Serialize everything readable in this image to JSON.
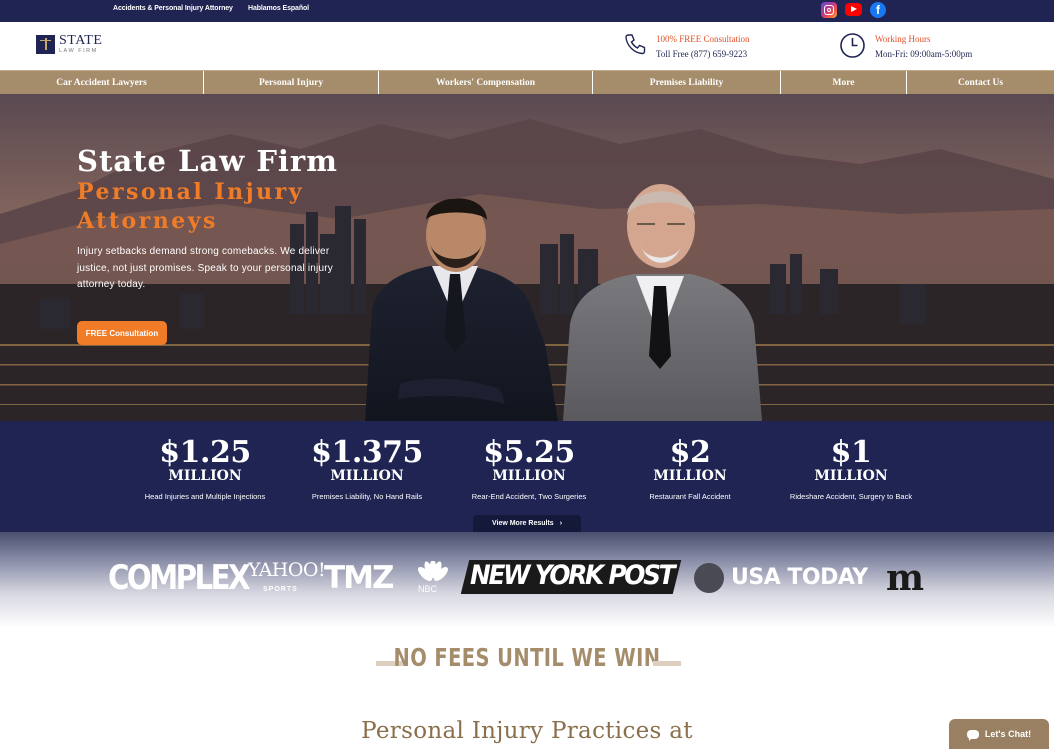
{
  "topbar": {
    "attorney_link": "Accidents & Personal Injury Attorney",
    "espanol_link": "Hablamos Español",
    "social_icons": [
      "instagram-icon",
      "youtube-icon",
      "facebook-icon"
    ]
  },
  "header": {
    "logo_title": "STATE",
    "logo_subtitle": "LAW FIRM",
    "consultation_label": "100% FREE Consultation",
    "toll_free": "Toll Free (877) 659-9223",
    "hours_label": "Working Hours",
    "hours_value": "Mon-Fri: 09:00am-5:00pm"
  },
  "nav": {
    "items": [
      {
        "label": "Car Accident Lawyers"
      },
      {
        "label": "Personal Injury"
      },
      {
        "label": "Workers' Compensation"
      },
      {
        "label": "Premises Liability"
      },
      {
        "label": "More"
      },
      {
        "label": "Contact Us"
      }
    ]
  },
  "hero": {
    "title": "State Law Firm",
    "subtitle": "Personal Injury Attorneys",
    "description": "Injury setbacks demand strong comebacks. We deliver justice, not just promises. Speak to your personal injury attorney today.",
    "cta_label": "FREE Consultation"
  },
  "results": {
    "items": [
      {
        "amount": "$1.25",
        "unit": "MILLION",
        "desc": "Head Injuries and Multiple Injections"
      },
      {
        "amount": "$1.375",
        "unit": "MILLION",
        "desc": "Premises Liability, No Hand Rails"
      },
      {
        "amount": "$5.25",
        "unit": "MILLION",
        "desc": "Rear-End Accident, Two Surgeries"
      },
      {
        "amount": "$2",
        "unit": "MILLION",
        "desc": "Restaurant Fall Accident"
      },
      {
        "amount": "$1",
        "unit": "MILLION",
        "desc": "Rideshare Accident, Surgery to Back"
      }
    ],
    "view_more": "View More Results"
  },
  "press": {
    "complex": "COMPLEX",
    "yahoo": "YAHOO!",
    "yahoo_sub": "SPORTS",
    "tmz": "TMZ",
    "nbc": "NBC",
    "nypost": "NEW YORK POST",
    "usatoday": "USA TODAY",
    "mail": "m"
  },
  "nofees": {
    "text": "NO FEES UNTIL WE WIN"
  },
  "practices": {
    "heading": "Personal Injury Practices at"
  },
  "chat": {
    "label": "Let's Chat!"
  },
  "colors": {
    "navy": "#1f2452",
    "gold": "#a58d6c",
    "orange": "#f07c28"
  }
}
